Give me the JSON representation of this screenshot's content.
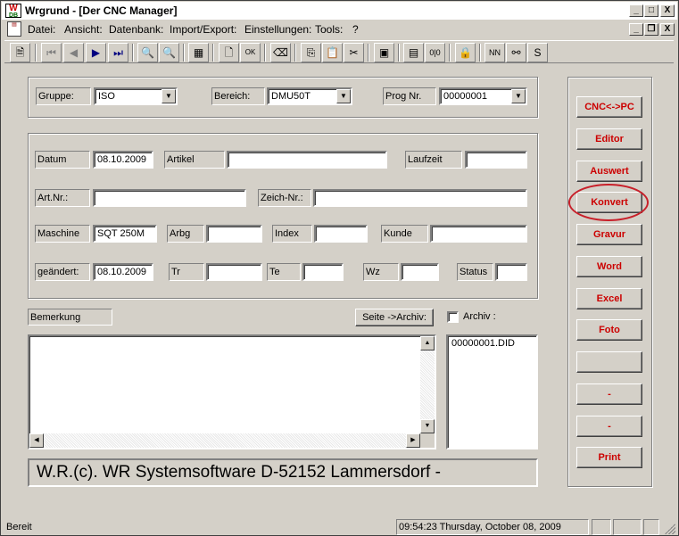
{
  "window": {
    "title": "Wrgrund - [Der CNC Manager]",
    "icon_text_top": "W",
    "icon_text_bottom": "DB",
    "caption_buttons": [
      "_",
      "□",
      "X"
    ]
  },
  "menu": {
    "items": [
      "Datei:",
      "Ansicht:",
      "Datenbank:",
      "Import/Export:",
      "Einstellungen:",
      "Tools:",
      "?"
    ],
    "mdi_buttons": [
      "_",
      "❐",
      "X"
    ]
  },
  "toolbar": {
    "icons": [
      "document-icon",
      "first-record-icon",
      "prev-record-icon",
      "next-record-icon",
      "last-record-icon",
      "zoom-in-icon",
      "zoom-out-icon",
      "calculator-icon",
      "new-document-icon",
      "ok-icon",
      "eraser-icon",
      "copy-icon",
      "paste-icon",
      "cut-icon",
      "database-icon",
      "grid-icon",
      "compare-icon",
      "lock-icon",
      "nn-icon",
      "binoculars-icon",
      "s-icon"
    ],
    "labels": {
      "nn": "NN",
      "s": "S",
      "ok": "OK"
    }
  },
  "header_group": {
    "gruppe_label": "Gruppe:",
    "gruppe_value": "ISO",
    "bereich_label": "Bereich:",
    "bereich_value": "DMU50T",
    "prog_label": "Prog Nr.",
    "prog_value": "00000001"
  },
  "details": {
    "datum_label": "Datum",
    "datum_value": "08.10.2009",
    "artikel_label": "Artikel",
    "artikel_value": "",
    "laufzeit_label": "Laufzeit",
    "laufzeit_value": "",
    "artnr_label": "Art.Nr.:",
    "artnr_value": "",
    "zeichnr_label": "Zeich-Nr.:",
    "zeichnr_value": "",
    "maschine_label": "Maschine",
    "maschine_value": "SQT 250M",
    "arbg_label": "Arbg",
    "arbg_value": "",
    "index_label": "Index",
    "index_value": "",
    "kunde_label": "Kunde",
    "kunde_value": "",
    "geaendert_label": "geändert:",
    "geaendert_value": "08.10.2009",
    "tr_label": "Tr",
    "tr_value": "",
    "te_label": "Te",
    "te_value": "",
    "wz_label": "Wz",
    "wz_value": "",
    "status_label": "Status",
    "status_value": ""
  },
  "bemerkung": {
    "label": "Bemerkung",
    "text": "",
    "seite_archiv_button": "Seite ->Archiv:",
    "archiv_label": "Archiv  :",
    "archiv_checked": false
  },
  "archive_list": [
    "00000001.DID"
  ],
  "banner": "W.R.(c). WR Systemsoftware  D-52152 Lammersdorf -",
  "side_buttons": [
    "CNC<->PC",
    "Editor",
    "Auswert",
    "Konvert",
    "Gravur",
    "Word",
    "Excel",
    "Foto",
    "",
    "-",
    "-",
    "Print"
  ],
  "highlighted_button": "Konvert",
  "status": {
    "left": "Bereit",
    "clock": "09:54:23 Thursday, October 08, 2009"
  },
  "colors": {
    "face": "#d4d0c8",
    "accent_red": "#cc0000",
    "highlight_ring": "#c8202a",
    "nav_arrows": "#000080"
  }
}
